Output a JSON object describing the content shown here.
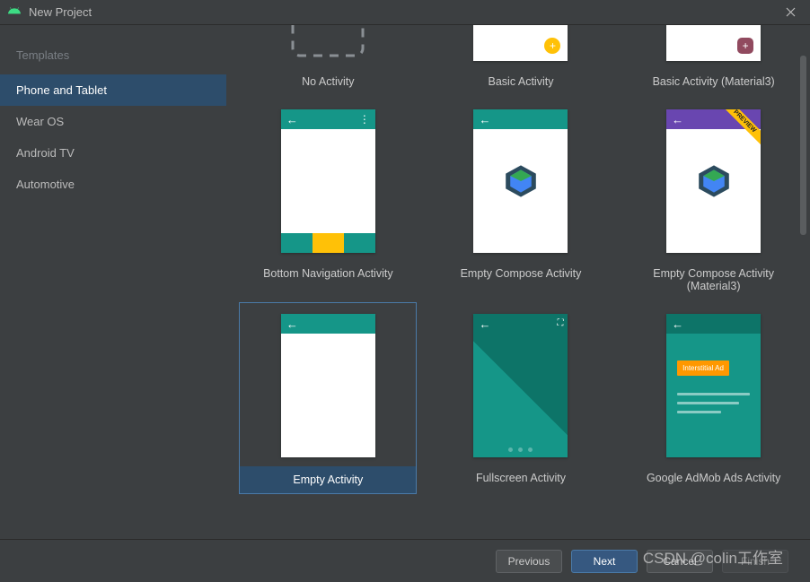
{
  "window": {
    "title": "New Project"
  },
  "sidebar": {
    "header": "Templates",
    "items": [
      {
        "label": "Phone and Tablet",
        "active": true
      },
      {
        "label": "Wear OS",
        "active": false
      },
      {
        "label": "Android TV",
        "active": false
      },
      {
        "label": "Automotive",
        "active": false
      }
    ]
  },
  "templates": [
    {
      "label": "No Activity"
    },
    {
      "label": "Basic Activity"
    },
    {
      "label": "Basic Activity (Material3)"
    },
    {
      "label": "Bottom Navigation Activity"
    },
    {
      "label": "Empty Compose Activity"
    },
    {
      "label": "Empty Compose Activity (Material3)"
    },
    {
      "label": "Empty Activity",
      "selected": true
    },
    {
      "label": "Fullscreen Activity"
    },
    {
      "label": "Google AdMob Ads Activity"
    }
  ],
  "admob": {
    "button_text": "Interstitial Ad"
  },
  "preview_badge": "PREVIEW",
  "buttons": {
    "previous": "Previous",
    "next": "Next",
    "cancel": "Cancel",
    "finish": "Finish"
  },
  "watermark": "CSDN @colin工作室"
}
